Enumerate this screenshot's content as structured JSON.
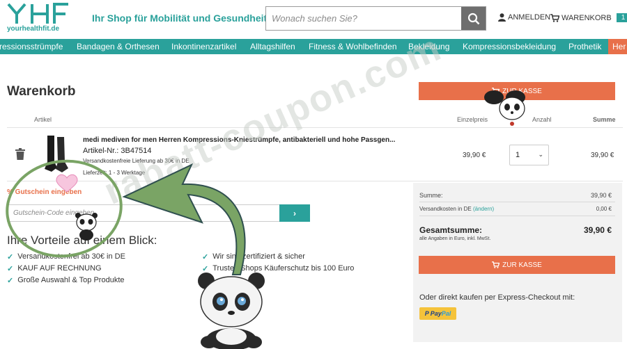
{
  "header": {
    "logo_text": "yourhealthfit.de",
    "tagline": "Ihr Shop für Mobilität und Gesundheit",
    "search_placeholder": "Wonach suchen Sie?",
    "login_label": "ANMELDEN",
    "cart_label": "WARENKORB",
    "cart_count": "1"
  },
  "nav": {
    "items": [
      "ressionsstrümpfe",
      "Bandagen & Orthesen",
      "Inkontinenzartikel",
      "Alltagshilfen",
      "Fitness & Wohlbefinden",
      "Bekleidung",
      "Kompressionsbekleidung",
      "Prothetik"
    ],
    "last_item": "Her"
  },
  "cart": {
    "title": "Warenkorb",
    "checkout_label": "ZUR KASSE",
    "col_article": "Artikel",
    "col_unit_price": "Einzelpreis",
    "col_quantity": "Anzahl",
    "col_sum": "Summe",
    "item": {
      "title": "medi mediven for men Herren Kompressions-Kniestrümpfe, antibakteriell und hohe Passgen...",
      "sku": "Artikel-Nr.: 3B47514",
      "shipping": "Versandkostenfreie Lieferung ab 30€ in DE",
      "delivery": "Lieferzeit: 1 - 3 Werktage",
      "unit_price": "39,90 €",
      "quantity": "1",
      "sum": "39,90 €"
    }
  },
  "coupon": {
    "label": "% Gutschein eingeben",
    "placeholder": "Gutschein-Code eingeben",
    "submit": "›"
  },
  "benefits": {
    "title": "Ihre Vorteile auf einem Blick:",
    "left": [
      "Versandkostenfrei ab 30€ in DE",
      "KAUF AUF RECHNUNG",
      "Große Auswahl & Top Produkte"
    ],
    "right": [
      "Wir sind zertifiziert & sicher",
      "Trusted Shops Käuferschutz bis 100 Euro"
    ]
  },
  "summary": {
    "subtotal_label": "Summe:",
    "subtotal_value": "39,90 €",
    "shipping_label": "Versandkosten in DE",
    "shipping_link": "(ändern)",
    "shipping_value": "0,00 €",
    "total_label": "Gesamtsumme:",
    "total_value": "39,90 €",
    "total_note": "alle Angaben in Euro, inkl. MwSt.",
    "checkout_label": "ZUR KASSE",
    "express_text": "Oder direkt kaufen per Express-Checkout mit:",
    "paypal_pay": "Pay",
    "paypal_pal": "Pal"
  },
  "overlay": {
    "watermark": "rabatt-coupon.com"
  },
  "colors": {
    "teal": "#2aa19b",
    "orange": "#e8704a",
    "summary_bg": "#f2f2f2",
    "arrow_green": "#7aa465"
  }
}
